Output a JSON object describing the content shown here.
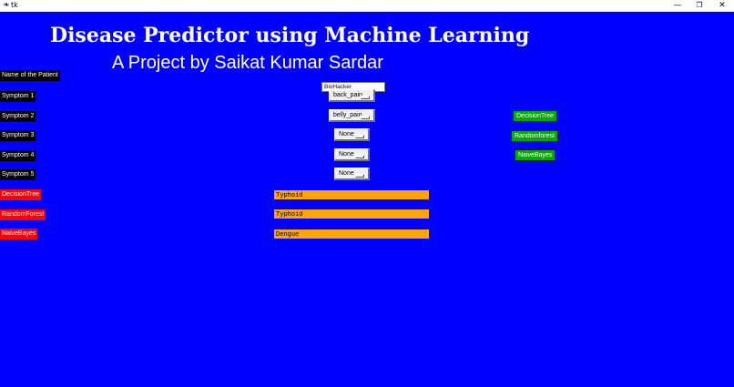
{
  "window": {
    "title": "tk",
    "app_icon": "feather-icon",
    "controls": {
      "minimize": "—",
      "maximize": "❐",
      "close": "✕"
    }
  },
  "header": {
    "title": "Disease Predictor using Machine Learning",
    "subtitle": "A Project by Saikat Kumar Sardar"
  },
  "form": {
    "name_label": "Name of the Patient",
    "name_value": "BioHacker",
    "symptoms": [
      {
        "label": "Symptom 1",
        "value": "back_pain"
      },
      {
        "label": "Symptom 2",
        "value": "belly_pain"
      },
      {
        "label": "Symptom 3",
        "value": "None"
      },
      {
        "label": "Symptom 4",
        "value": "None"
      },
      {
        "label": "Symptom 5",
        "value": "None"
      }
    ]
  },
  "buttons": {
    "decision_tree": "DecisionTree",
    "random_forest": "Randomforest",
    "naive_bayes": "NaiveBayes"
  },
  "results": [
    {
      "label": "DecisionTree",
      "value": "Typhoid"
    },
    {
      "label": "RandomForest",
      "value": "Typhoid"
    },
    {
      "label": "NaiveBayes",
      "value": "Dengue"
    }
  ],
  "colors": {
    "background": "#0000ff",
    "label_bg": "#000000",
    "result_label_bg": "#ff0000",
    "result_bg": "#ffa500",
    "button_bg": "#00aa00"
  }
}
